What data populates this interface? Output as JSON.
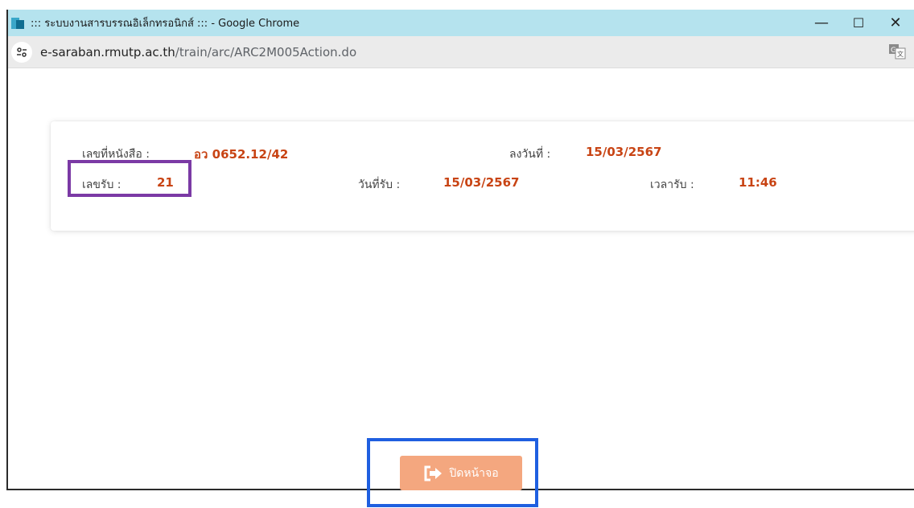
{
  "window": {
    "title": "::: ระบบงานสารบรรณอิเล็กทรอนิกส์ ::: - Google Chrome",
    "controls": {
      "minimize": "—",
      "maximize": "☐",
      "close": "✕"
    }
  },
  "addressbar": {
    "url_host": "e-saraban.rmutp.ac.th",
    "url_path": "/train/arc/ARC2M005Action.do",
    "site_icon": "tune-icon",
    "translate_icon": "translate-icon"
  },
  "document_info": {
    "book_no_label": "เลขที่หนังสือ :",
    "book_no_value": "อว 0652.12/42",
    "dated_label": "ลงวันที่ :",
    "dated_value": "15/03/2567",
    "receive_no_label": "เลขรับ :",
    "receive_no_value": "21",
    "receive_date_label": "วันที่รับ :",
    "receive_date_value": "15/03/2567",
    "receive_time_label": "เวลารับ :",
    "receive_time_value": "11:46"
  },
  "close_button": {
    "label": "ปิดหน้าจอ",
    "icon": "sign-out-icon"
  },
  "colors": {
    "accent_value": "#c84414",
    "button": "#f4a77f",
    "highlight_purple": "#7b3aa5",
    "highlight_blue": "#1f5fe0"
  }
}
